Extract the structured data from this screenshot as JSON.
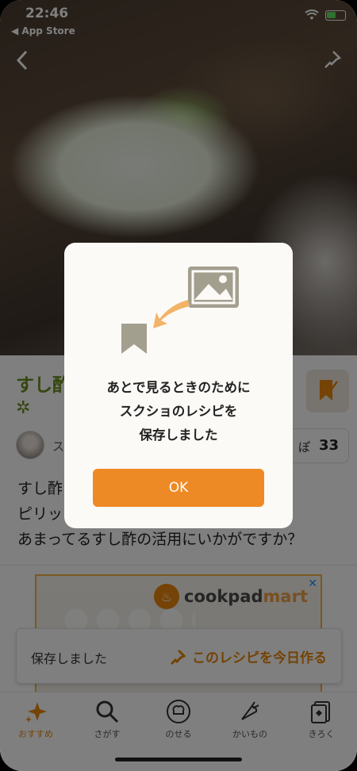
{
  "status_bar": {
    "time": "22:46",
    "back_app": "◀ App Store"
  },
  "recipe": {
    "title": "すし酢",
    "title_mark": "✲",
    "author_name": "ス",
    "tsukurepo_label": "ぽ",
    "tsukurepo_count": "33",
    "description": [
      "すし酢",
      "ピリッ",
      "あまってるすし酢の活用にいかがですか？"
    ]
  },
  "ad": {
    "logo_main": "cookpad",
    "logo_sub": "mart",
    "close": "✕"
  },
  "toast": {
    "message": "保存しました",
    "action": "このレシピを今日作る"
  },
  "tabs": [
    {
      "label": "おすすめ",
      "icon": "sparkle-icon"
    },
    {
      "label": "さがす",
      "icon": "search-icon"
    },
    {
      "label": "のせる",
      "icon": "chef-icon"
    },
    {
      "label": "かいもの",
      "icon": "vegetables-icon"
    },
    {
      "label": "きろく",
      "icon": "record-icon"
    }
  ],
  "modal": {
    "lines": [
      "あとで見るときのために",
      "スクショのレシピを",
      "保存しました"
    ],
    "ok_label": "OK"
  },
  "colors": {
    "accent": "#ee8a26",
    "title_green": "#6b8e1e",
    "modal_bg": "#fbfaf6"
  }
}
